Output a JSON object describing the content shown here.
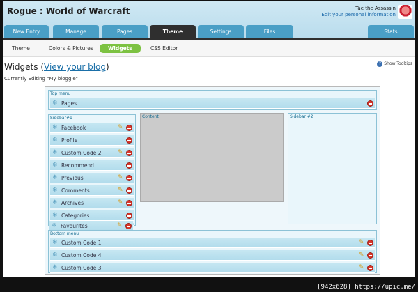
{
  "header": {
    "site_title": "Rogue : World of Warcraft",
    "user_name": "Tae the Assassin",
    "user_link": "Edit your personal information"
  },
  "tabs": [
    {
      "label": "New Entry"
    },
    {
      "label": "Manage"
    },
    {
      "label": "Pages"
    },
    {
      "label": "Theme"
    },
    {
      "label": "Settings"
    },
    {
      "label": "Files"
    },
    {
      "label": "Stats"
    }
  ],
  "subnav": [
    {
      "label": "Theme"
    },
    {
      "label": "Colors & Pictures"
    },
    {
      "label": "Widgets"
    },
    {
      "label": "CSS Editor"
    }
  ],
  "page": {
    "heading_prefix": "Widgets (",
    "heading_link": "View your blog",
    "heading_suffix": ")",
    "editing": "Currently Editing \"My bloggie\"",
    "tooltips": "Show Tooltips"
  },
  "zones": {
    "top_menu": {
      "label": "Top menu",
      "widgets": [
        {
          "label": "Pages"
        }
      ]
    },
    "sidebar1": {
      "label": "Sidebar#1",
      "widgets": [
        {
          "label": "Facebook"
        },
        {
          "label": "Profile"
        },
        {
          "label": "Custom Code 2"
        },
        {
          "label": "Recommend"
        },
        {
          "label": "Previous"
        },
        {
          "label": "Comments"
        },
        {
          "label": "Archives"
        },
        {
          "label": "Categories"
        },
        {
          "label": "Favourites"
        }
      ]
    },
    "content": {
      "label": "Content"
    },
    "sidebar2": {
      "label": "Sidebar #2"
    },
    "bottom_menu": {
      "label": "Bottom menu",
      "widgets": [
        {
          "label": "Custom Code 1"
        },
        {
          "label": "Custom Code 4"
        },
        {
          "label": "Custom Code 3"
        }
      ]
    }
  },
  "watermark": "[942x628] https://upic.me/"
}
